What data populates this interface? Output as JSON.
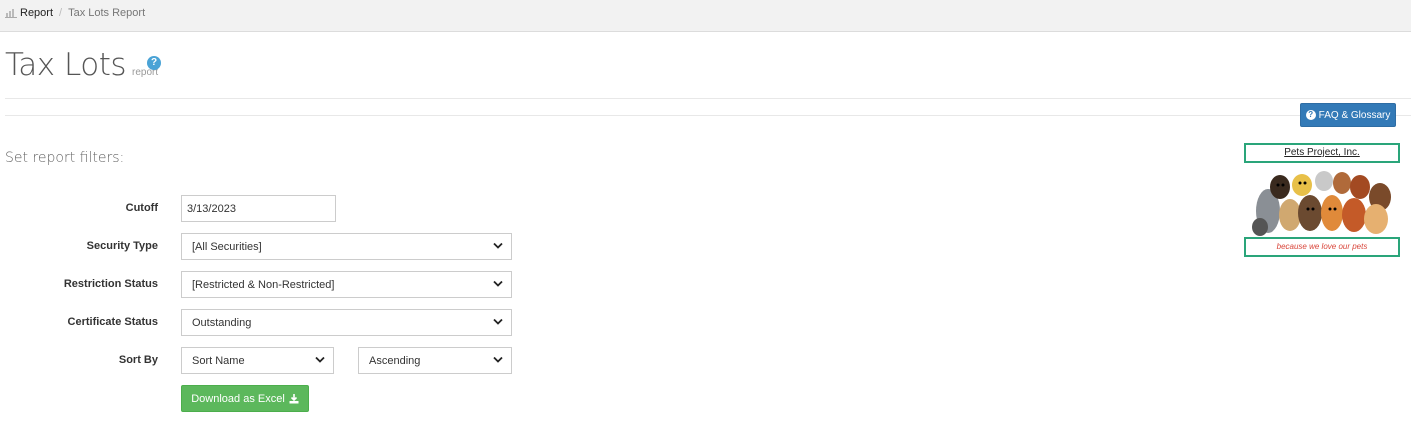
{
  "breadcrumb": {
    "root": "Report",
    "separator": "/",
    "current": "Tax Lots Report"
  },
  "page": {
    "title": "Tax Lots",
    "subtitle": "report"
  },
  "faq_button": {
    "label": "FAQ & Glossary"
  },
  "filters": {
    "heading": "Set report filters:",
    "cutoff": {
      "label": "Cutoff",
      "value": "3/13/2023"
    },
    "security_type": {
      "label": "Security Type",
      "value": "[All Securities]"
    },
    "restriction_status": {
      "label": "Restriction Status",
      "value": "[Restricted & Non-Restricted]"
    },
    "certificate_status": {
      "label": "Certificate Status",
      "value": "Outstanding"
    },
    "sort_by": {
      "label": "Sort By",
      "field_value": "Sort Name",
      "order_value": "Ascending"
    }
  },
  "download_button": {
    "label": "Download as Excel"
  },
  "logo": {
    "company": "Pets Project, Inc.",
    "tagline": "because we love our pets"
  },
  "colors": {
    "primary": "#337ab7",
    "success": "#5cb85c",
    "info": "#4aa3d6",
    "logo_border": "#2aa57a"
  }
}
